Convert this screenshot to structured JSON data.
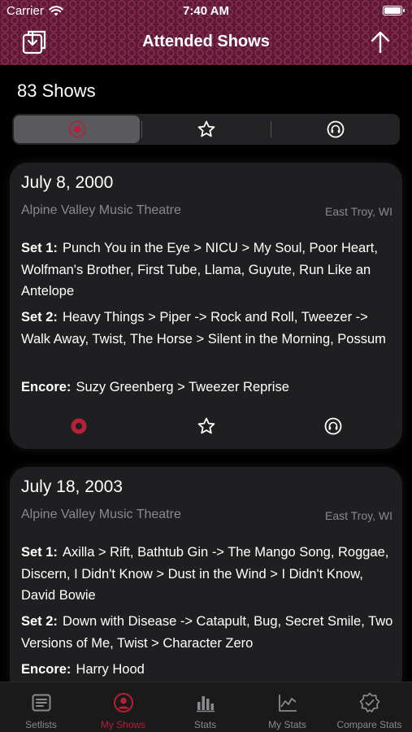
{
  "status_bar": {
    "carrier": "Carrier",
    "time": "7:40 AM"
  },
  "nav": {
    "title": "Attended Shows",
    "left_icon": "import-icon",
    "right_icon": "arrow-up-icon"
  },
  "summary": {
    "count_label": "83 Shows"
  },
  "segmented": {
    "selected_index": 0,
    "segments": [
      {
        "icon": "record-icon"
      },
      {
        "icon": "star-icon"
      },
      {
        "icon": "headphones-icon"
      }
    ]
  },
  "colors": {
    "accent": "#b3213a",
    "header_bg": "#5e1a35",
    "card_bg": "#1f1f21",
    "muted_text": "#8a8a8e"
  },
  "shows": [
    {
      "date": "July 8, 2000",
      "venue": "Alpine Valley Music Theatre",
      "city": "East Troy, WI",
      "sets": [
        {
          "label": "Set 1:",
          "songs": "Punch You in the Eye > NICU > My Soul, Poor Heart, Wolfman's Brother, First Tube, Llama, Guyute, Run Like an Antelope"
        },
        {
          "label": "Set 2:",
          "songs": "Heavy Things > Piper -> Rock and Roll, Tweezer -> Walk Away, Twist, The Horse > Silent in the Morning, Possum"
        },
        {
          "label": "Encore:",
          "songs": "Suzy Greenberg > Tweezer Reprise"
        }
      ]
    },
    {
      "date": "July 18, 2003",
      "venue": "Alpine Valley Music Theatre",
      "city": "East Troy, WI",
      "sets": [
        {
          "label": "Set 1:",
          "songs": "Axilla > Rift, Bathtub Gin -> The Mango Song, Roggae, Discern, I Didn't Know > Dust in the Wind > I Didn't Know, David Bowie"
        },
        {
          "label": "Set 2:",
          "songs": "Down with Disease -> Catapult, Bug, Secret Smile, Two Versions of Me, Twist > Character Zero"
        },
        {
          "label": "Encore:",
          "songs": "Harry Hood"
        }
      ]
    }
  ],
  "tabbar": {
    "active_index": 1,
    "tabs": [
      {
        "label": "Setlists",
        "icon": "list-icon"
      },
      {
        "label": "My Shows",
        "icon": "person-icon"
      },
      {
        "label": "Stats",
        "icon": "bar-chart-icon"
      },
      {
        "label": "My Stats",
        "icon": "line-chart-icon"
      },
      {
        "label": "Compare Stats",
        "icon": "checkmark-seal-icon"
      }
    ]
  }
}
